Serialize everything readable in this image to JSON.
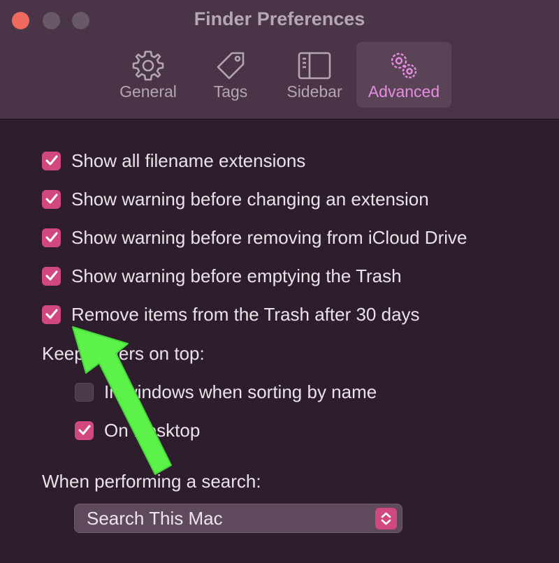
{
  "window": {
    "title": "Finder Preferences"
  },
  "toolbar": {
    "tabs": [
      {
        "label": "General",
        "icon": "gear-icon"
      },
      {
        "label": "Tags",
        "icon": "tag-icon"
      },
      {
        "label": "Sidebar",
        "icon": "sidebar-icon"
      },
      {
        "label": "Advanced",
        "icon": "gears-icon",
        "active": true
      }
    ]
  },
  "options": [
    {
      "label": "Show all filename extensions",
      "checked": true
    },
    {
      "label": "Show warning before changing an extension",
      "checked": true
    },
    {
      "label": "Show warning before removing from iCloud Drive",
      "checked": true
    },
    {
      "label": "Show warning before emptying the Trash",
      "checked": true
    },
    {
      "label": "Remove items from the Trash after 30 days",
      "checked": true
    }
  ],
  "keep_folders": {
    "heading": "Keep folders on top:",
    "items": [
      {
        "label": "In windows when sorting by name",
        "checked": false
      },
      {
        "label": "On Desktop",
        "checked": true
      }
    ]
  },
  "search": {
    "heading": "When performing a search:",
    "selected": "Search This Mac"
  },
  "colors": {
    "accent": "#d1487f",
    "active_tab_text": "#e58de0",
    "annotation_arrow": "#5cf24a"
  }
}
